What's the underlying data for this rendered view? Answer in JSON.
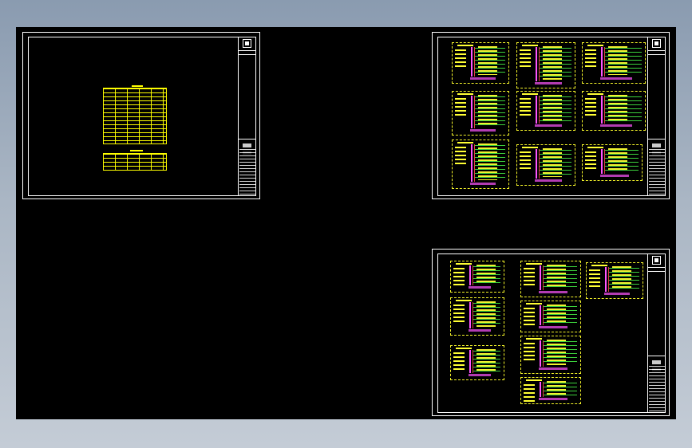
{
  "viewport": {
    "background": "#000000"
  },
  "colors": {
    "frame": "#ffffff",
    "text_yellow": "#ffff33",
    "bus_magenta": "#ff55ff",
    "bus_red": "#e04040",
    "wire_green": "#3cd23c"
  },
  "sheets": [
    {
      "id": "sheet-1",
      "content": "equipment-table"
    },
    {
      "id": "sheet-2",
      "content": "schematic-diagrams",
      "blocks": 9
    },
    {
      "id": "sheet-3",
      "content": "schematic-diagrams",
      "blocks": 9
    }
  ]
}
